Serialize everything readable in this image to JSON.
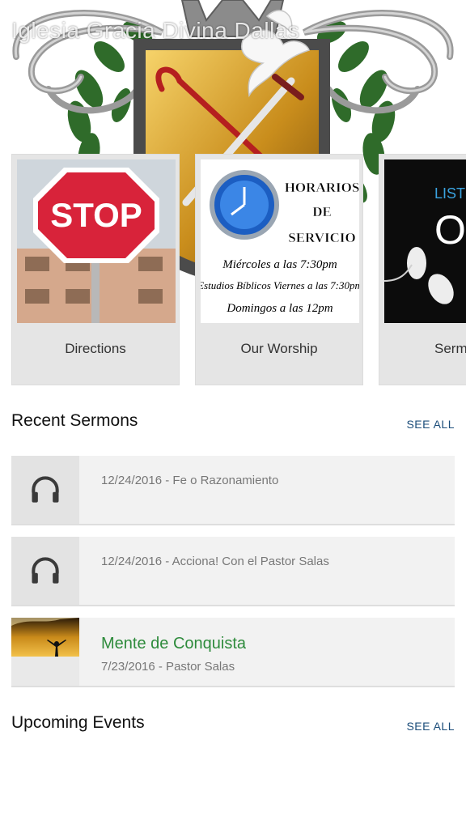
{
  "header": {
    "app_title": "Iglesia Gracia Divina Dallas"
  },
  "features": [
    {
      "label": "Directions",
      "image_text": "STOP"
    },
    {
      "label": "Our Worship",
      "image_lines": [
        "HORARIOS",
        "DE",
        "SERVICIO",
        "Miércoles a las 7:30pm",
        "Estudios Bíblicos Viernes a las 7:30pm",
        "Domingos a las 12pm"
      ]
    },
    {
      "label": "Serm",
      "image_lines": [
        "LISTEN",
        "ON"
      ]
    }
  ],
  "recent_sermons": {
    "title": "Recent Sermons",
    "see_all": "SEE ALL",
    "items": [
      {
        "meta": "12/24/2016 - Fe o Razonamiento",
        "icon": "headphones-icon"
      },
      {
        "meta": "12/24/2016 - Acciona! Con el Pastor Salas",
        "icon": "headphones-icon"
      },
      {
        "title": "Mente de Conquista",
        "meta": "7/23/2016 - Pastor Salas",
        "icon": "sunset-thumbnail"
      }
    ]
  },
  "upcoming_events": {
    "title": "Upcoming Events",
    "see_all": "SEE ALL"
  },
  "colors": {
    "link": "#1b4d7a",
    "highlight_title": "#2e8b3c",
    "card_bg": "#e5e5e5",
    "row_bg": "#f2f2f2"
  }
}
